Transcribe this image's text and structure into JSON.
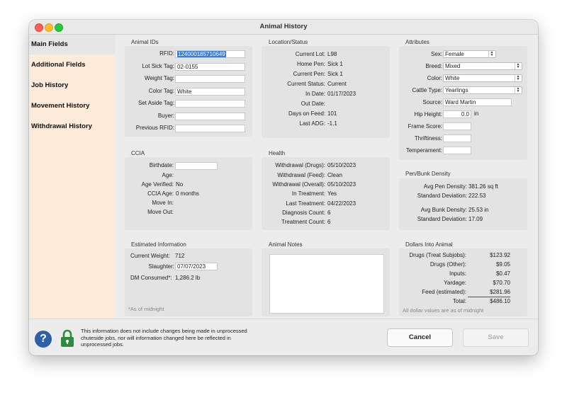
{
  "window": {
    "title": "Animal History"
  },
  "sidebar": {
    "items": [
      {
        "label": "Main Fields"
      },
      {
        "label": "Additional Fields"
      },
      {
        "label": "Job History"
      },
      {
        "label": "Movement History"
      },
      {
        "label": "Withdrawal History"
      }
    ]
  },
  "animal_ids": {
    "title": "Animal IDs",
    "rfid_label": "RFID:",
    "rfid_value": "124000185710649",
    "lot_sick_tag_label": "Lot Sick Tag:",
    "lot_sick_tag_value": "02-0155",
    "weight_tag_label": "Weight Tag:",
    "weight_tag_value": "",
    "color_tag_label": "Color Tag:",
    "color_tag_value": "White",
    "set_aside_tag_label": "Set Aside Tag:",
    "set_aside_tag_value": "",
    "buyer_label": "Buyer:",
    "buyer_value": "",
    "previous_rfid_label": "Previous RFID:",
    "previous_rfid_value": ""
  },
  "location_status": {
    "title": "Location/Status",
    "current_lot_label": "Current Lot:",
    "current_lot_value": "L98",
    "home_pen_label": "Home Pen:",
    "home_pen_value": "Sick 1",
    "current_pen_label": "Current Pen:",
    "current_pen_value": "Sick 1",
    "current_status_label": "Current Status:",
    "current_status_value": "Current",
    "in_date_label": "In Date:",
    "in_date_value": "01/17/2023",
    "out_date_label": "Out Date:",
    "out_date_value": "",
    "days_on_feed_label": "Days on Feed:",
    "days_on_feed_value": "101",
    "last_adg_label": "Last ADG:",
    "last_adg_value": "-1.1"
  },
  "attributes": {
    "title": "Attributes",
    "sex_label": "Sex:",
    "sex_value": "Female",
    "breed_label": "Breed:",
    "breed_value": "Mixed",
    "color_label": "Color:",
    "color_value": "White",
    "cattle_type_label": "Cattle Type:",
    "cattle_type_value": "Yearlings",
    "source_label": "Source:",
    "source_value": "Ward Martin",
    "hip_height_label": "Hip Height:",
    "hip_height_value": "0.0",
    "hip_height_unit": "in",
    "frame_score_label": "Frame Score:",
    "frame_score_value": "",
    "thriftiness_label": "Thriftiness:",
    "thriftiness_value": "",
    "temperament_label": "Temperament:",
    "temperament_value": ""
  },
  "ccia": {
    "title": "CCIA",
    "birthdate_label": "Birthdate:",
    "birthdate_value": "",
    "age_label": "Age:",
    "age_value": "",
    "age_verified_label": "Age Verified:",
    "age_verified_value": "No",
    "ccia_age_label": "CCIA Age:",
    "ccia_age_value": "0 months",
    "move_in_label": "Move In:",
    "move_in_value": "",
    "move_out_label": "Move Out:",
    "move_out_value": ""
  },
  "health": {
    "title": "Health",
    "wd_drugs_label": "Withdrawal (Drugs):",
    "wd_drugs_value": "05/10/2023",
    "wd_feed_label": "Withdrawal (Feed):",
    "wd_feed_value": "Clean",
    "wd_overall_label": "Withdrawal (Overall):",
    "wd_overall_value": "05/10/2023",
    "in_treatment_label": "In Treatment:",
    "in_treatment_value": "Yes",
    "last_treatment_label": "Last Treatment:",
    "last_treatment_value": "04/22/2023",
    "diagnosis_count_label": "Diagnosis Count:",
    "diagnosis_count_value": "6",
    "treatment_count_label": "Treatment Count:",
    "treatment_count_value": "6"
  },
  "pen_density": {
    "title": "Pen/Bunk Density",
    "avg_pen_label": "Avg Pen Density:",
    "avg_pen_value": "381.26 sq ft",
    "std_dev1_label": "Standard Deviation:",
    "std_dev1_value": "222.53",
    "avg_bunk_label": "Avg Bunk Density:",
    "avg_bunk_value": "25.53 in",
    "std_dev2_label": "Standard Deviation:",
    "std_dev2_value": "17.09"
  },
  "estimated": {
    "title": "Estimated Information",
    "current_weight_label": "Current Weight:",
    "current_weight_value": "712",
    "slaughter_label": "Slaughter:",
    "slaughter_value": "07/07/2023",
    "dm_consumed_label": "DM Consumed*:",
    "dm_consumed_value": "1,286.2 lb",
    "footnote": "*As of midnight"
  },
  "animal_notes": {
    "title": "Animal Notes",
    "text": ""
  },
  "dollars": {
    "title": "Dollars Into Animal",
    "rows": [
      {
        "label": "Drugs (Treat Subjobs):",
        "value": "$123.92"
      },
      {
        "label": "Drugs (Other):",
        "value": "$9.05"
      },
      {
        "label": "Inputs:",
        "value": "$0.47"
      },
      {
        "label": "Yardage:",
        "value": "$70.70"
      },
      {
        "label": "Feed (estimated):",
        "value": "$281.96"
      },
      {
        "label": "Total:",
        "value": "$486.10"
      }
    ],
    "footnote": "All dollar values are as of midnight"
  },
  "footer": {
    "info_text": "This information does not include changes being made in unprocessed chuteside jobs, nor will information changed here be reflected in unprocessed jobs.",
    "cancel_label": "Cancel",
    "save_label": "Save",
    "help_glyph": "?"
  }
}
